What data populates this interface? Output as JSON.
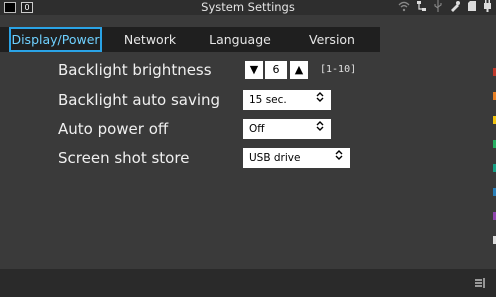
{
  "titlebar": {
    "badge_text": "0",
    "title": "System Settings",
    "status_icons": [
      "wifi-icon",
      "network-icon",
      "usb-icon",
      "pen-icon",
      "sd-card-icon",
      "battery-icon"
    ]
  },
  "tabs": [
    {
      "label": "Display/Power",
      "active": true
    },
    {
      "label": "Network",
      "active": false
    },
    {
      "label": "Language",
      "active": false
    },
    {
      "label": "Version",
      "active": false
    }
  ],
  "settings": {
    "backlight_brightness": {
      "label": "Backlight brightness",
      "value": "6",
      "range": "[1-10]"
    },
    "backlight_auto_saving": {
      "label": "Backlight auto saving",
      "value": "15 sec."
    },
    "auto_power_off": {
      "label": "Auto power off",
      "value": "Off"
    },
    "screen_shot_store": {
      "label": "Screen shot store",
      "value": "USB drive"
    }
  },
  "colors": {
    "accent": "#2aa3e6",
    "background": "#3a3a3a",
    "edge_marks": [
      "#c0392b",
      "#e67e22",
      "#f1c40f",
      "#27ae60",
      "#16a085",
      "#2980b9",
      "#8e44ad",
      "#dddddd"
    ]
  }
}
